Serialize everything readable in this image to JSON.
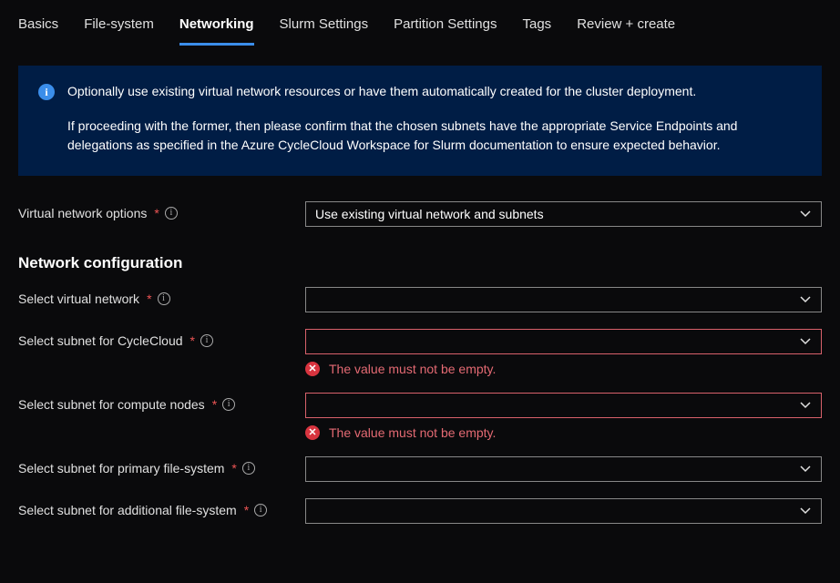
{
  "tabs": {
    "basics": "Basics",
    "filesystem": "File-system",
    "networking": "Networking",
    "slurm": "Slurm Settings",
    "partition": "Partition Settings",
    "tags": "Tags",
    "review": "Review + create"
  },
  "info": {
    "line1": "Optionally use existing virtual network resources or have them automatically created for the cluster deployment.",
    "line2": "If proceeding with the former, then please confirm that the chosen subnets have the appropriate Service Endpoints and delegations as specified in the Azure CycleCloud Workspace for Slurm documentation to ensure expected behavior."
  },
  "labels": {
    "vnet_options": "Virtual network options",
    "section": "Network configuration",
    "select_vnet": "Select virtual network",
    "subnet_cyclecloud": "Select subnet for CycleCloud",
    "subnet_compute": "Select subnet for compute nodes",
    "subnet_primary_fs": "Select subnet for primary file-system",
    "subnet_additional_fs": "Select subnet for additional file-system"
  },
  "values": {
    "vnet_options": "Use existing virtual network and subnets",
    "select_vnet": "",
    "subnet_cyclecloud": "",
    "subnet_compute": "",
    "subnet_primary_fs": "",
    "subnet_additional_fs": ""
  },
  "errors": {
    "empty": "The value must not be empty."
  }
}
